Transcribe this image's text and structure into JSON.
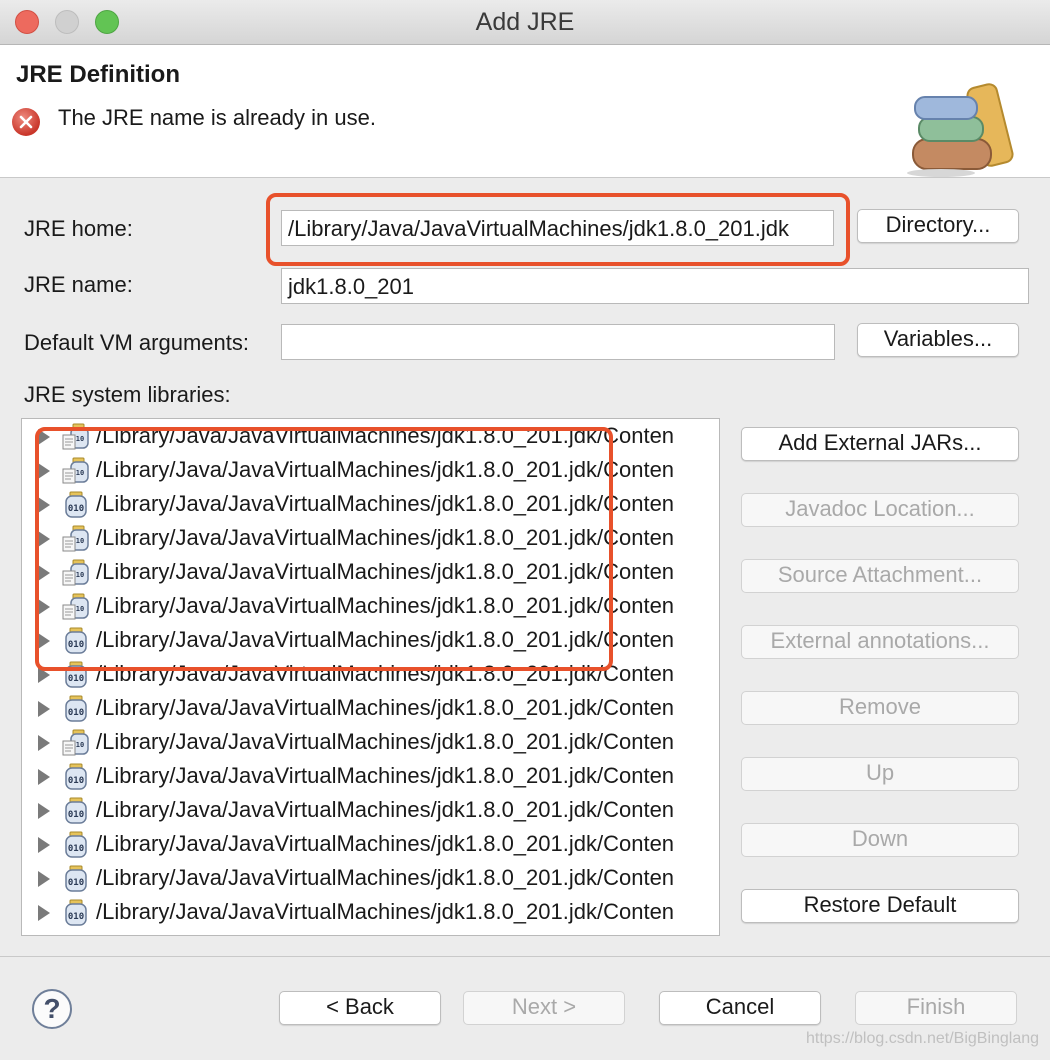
{
  "window": {
    "title": "Add JRE",
    "traffic_lights": [
      "#ed6a5e",
      "#d0d0d0",
      "#62c454"
    ]
  },
  "header": {
    "title": "JRE Definition",
    "message": "The JRE name is already in use.",
    "error_icon": "error-circle-x-icon",
    "banner_icon": "books-icon"
  },
  "form": {
    "jre_home_label": "JRE home:",
    "jre_home_value": "/Library/Java/JavaVirtualMachines/jdk1.8.0_201.jdk",
    "directory_button": "Directory...",
    "jre_name_label": "JRE name:",
    "jre_name_value": "jdk1.8.0_201",
    "vm_args_label": "Default VM arguments:",
    "vm_args_value": "",
    "variables_button": "Variables...",
    "libraries_label": "JRE system libraries:"
  },
  "libraries": [
    {
      "text": "/Library/Java/JavaVirtualMachines/jdk1.8.0_201.jdk/Conten",
      "icon": "source-jar-icon"
    },
    {
      "text": "/Library/Java/JavaVirtualMachines/jdk1.8.0_201.jdk/Conten",
      "icon": "source-jar-icon"
    },
    {
      "text": "/Library/Java/JavaVirtualMachines/jdk1.8.0_201.jdk/Conten",
      "icon": "jar-icon"
    },
    {
      "text": "/Library/Java/JavaVirtualMachines/jdk1.8.0_201.jdk/Conten",
      "icon": "source-jar-icon"
    },
    {
      "text": "/Library/Java/JavaVirtualMachines/jdk1.8.0_201.jdk/Conten",
      "icon": "source-jar-icon"
    },
    {
      "text": "/Library/Java/JavaVirtualMachines/jdk1.8.0_201.jdk/Conten",
      "icon": "source-jar-icon"
    },
    {
      "text": "/Library/Java/JavaVirtualMachines/jdk1.8.0_201.jdk/Conten",
      "icon": "jar-icon"
    },
    {
      "text": "/Library/Java/JavaVirtualMachines/jdk1.8.0_201.jdk/Conten",
      "icon": "jar-icon"
    },
    {
      "text": "/Library/Java/JavaVirtualMachines/jdk1.8.0_201.jdk/Conten",
      "icon": "jar-icon"
    },
    {
      "text": "/Library/Java/JavaVirtualMachines/jdk1.8.0_201.jdk/Conten",
      "icon": "source-jar-icon"
    },
    {
      "text": "/Library/Java/JavaVirtualMachines/jdk1.8.0_201.jdk/Conten",
      "icon": "jar-icon"
    },
    {
      "text": "/Library/Java/JavaVirtualMachines/jdk1.8.0_201.jdk/Conten",
      "icon": "jar-icon"
    },
    {
      "text": "/Library/Java/JavaVirtualMachines/jdk1.8.0_201.jdk/Conten",
      "icon": "jar-icon"
    },
    {
      "text": "/Library/Java/JavaVirtualMachines/jdk1.8.0_201.jdk/Conten",
      "icon": "jar-icon"
    },
    {
      "text": "/Library/Java/JavaVirtualMachines/jdk1.8.0_201.jdk/Conten",
      "icon": "jar-icon"
    }
  ],
  "side_buttons": {
    "add_external_jars": "Add External JARs...",
    "javadoc_location": "Javadoc Location...",
    "source_attachment": "Source Attachment...",
    "external_annotations": "External annotations...",
    "remove": "Remove",
    "up": "Up",
    "down": "Down",
    "restore_default": "Restore Default"
  },
  "footer": {
    "help": "?",
    "back": "< Back",
    "next": "Next >",
    "cancel": "Cancel",
    "finish": "Finish",
    "watermark": "https://blog.csdn.net/BigBinglang"
  },
  "colors": {
    "highlight": "#e8512b",
    "error": "#c9362a"
  }
}
